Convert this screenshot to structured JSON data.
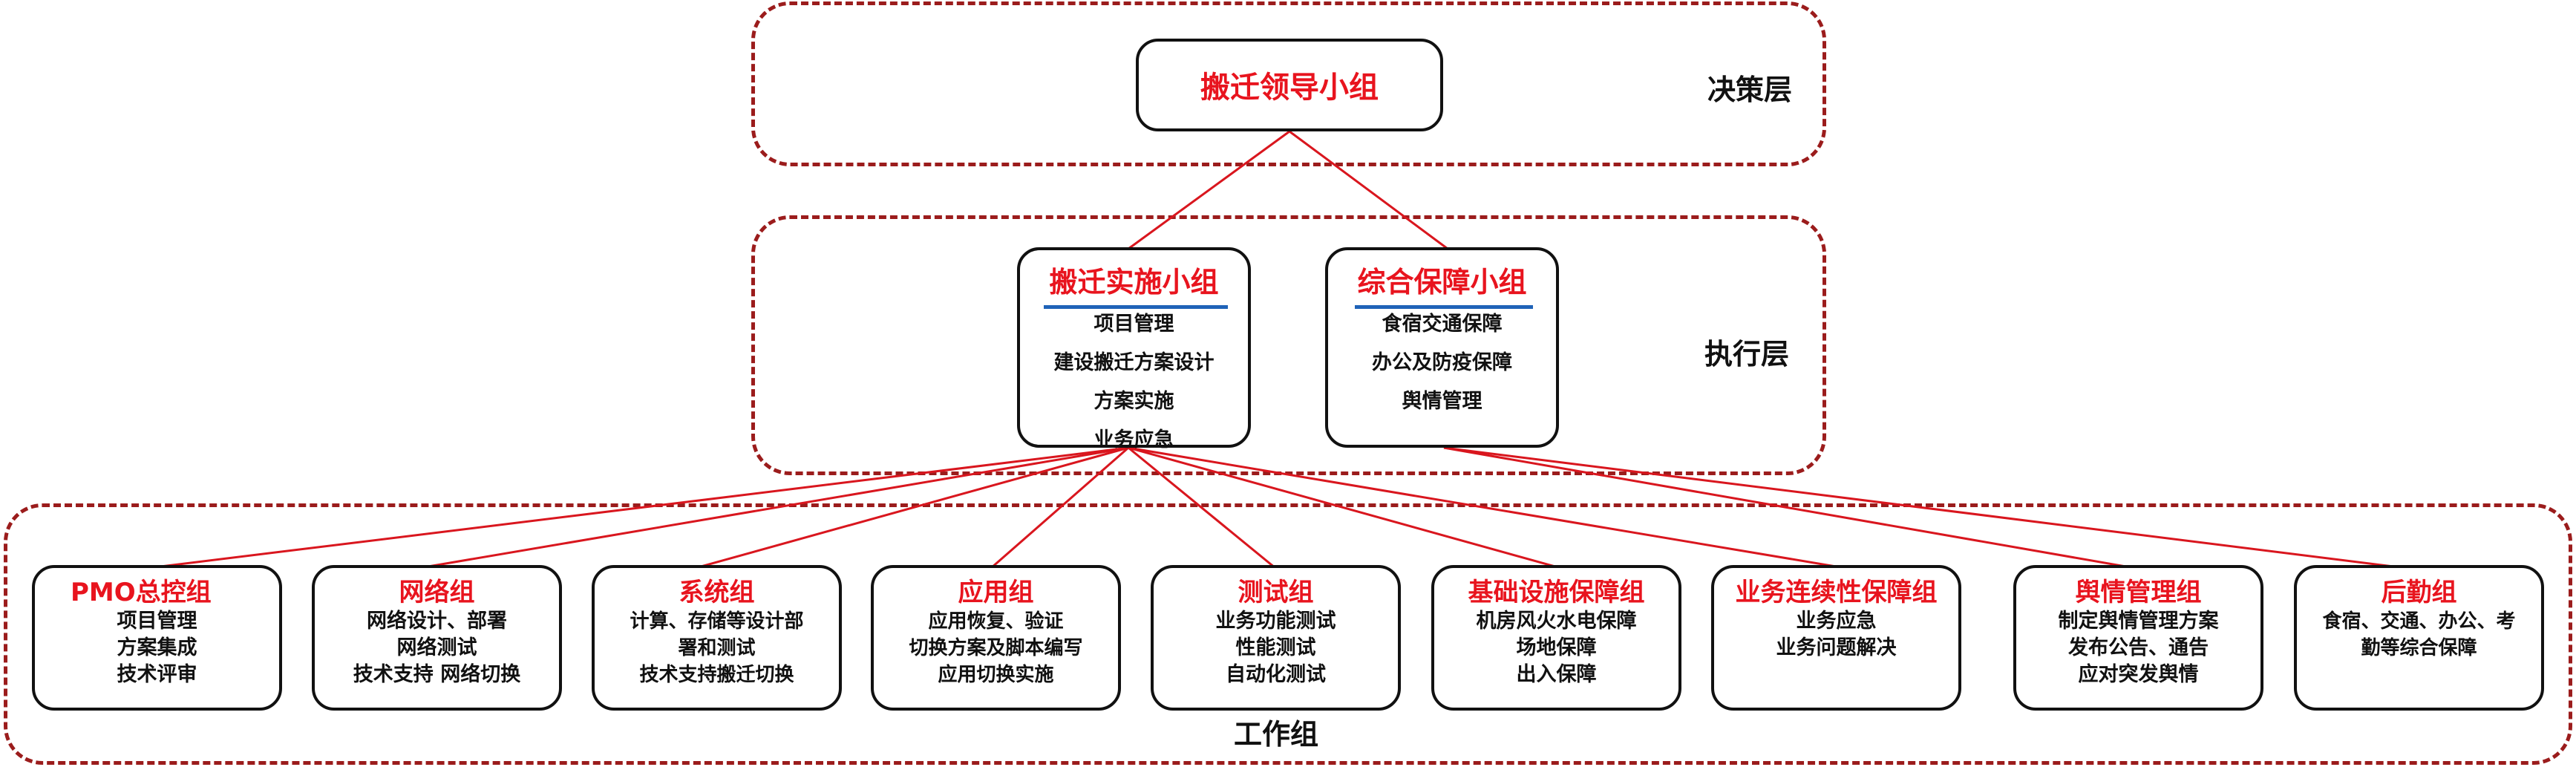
{
  "tiers": {
    "decision": "决策层",
    "execution": "执行层",
    "work": "工作组"
  },
  "leader": {
    "title": "搬迁领导小组"
  },
  "exec_groups": [
    {
      "title": "搬迁实施小组",
      "lines": [
        "项目管理",
        "建设搬迁方案设计",
        "方案实施",
        "业务应急"
      ]
    },
    {
      "title": "综合保障小组",
      "lines": [
        "食宿交通保障",
        "办公及防疫保障",
        "舆情管理"
      ]
    }
  ],
  "work_groups": [
    {
      "title": "PMO总控组",
      "lines": [
        "项目管理",
        "方案集成",
        "技术评审"
      ]
    },
    {
      "title": "网络组",
      "lines": [
        "网络设计、部署",
        "网络测试",
        "技术支持 网络切换"
      ]
    },
    {
      "title": "系统组",
      "lines": [
        "计算、存储等设计部",
        "署和测试",
        "技术支持搬迁切换"
      ]
    },
    {
      "title": "应用组",
      "lines": [
        "应用恢复、验证",
        "切换方案及脚本编写",
        "应用切换实施"
      ]
    },
    {
      "title": "测试组",
      "lines": [
        "业务功能测试",
        "性能测试",
        "自动化测试"
      ]
    },
    {
      "title": "基础设施保障组",
      "lines": [
        "机房风火水电保障",
        "场地保障",
        "出入保障"
      ]
    },
    {
      "title": "业务连续性保障组",
      "lines": [
        "业务应急",
        "业务问题解决"
      ]
    },
    {
      "title": "舆情管理组",
      "lines": [
        "制定舆情管理方案",
        "发布公告、通告",
        "应对突发舆情"
      ]
    },
    {
      "title": "后勤组",
      "lines": [
        "食宿、交通、办公、考",
        "勤等综合保障"
      ]
    }
  ],
  "colors": {
    "title_red": "#e8141e",
    "connector_red": "#d9161e",
    "tier_border": "#9b1c1c",
    "underline_blue": "#1f63b8"
  }
}
